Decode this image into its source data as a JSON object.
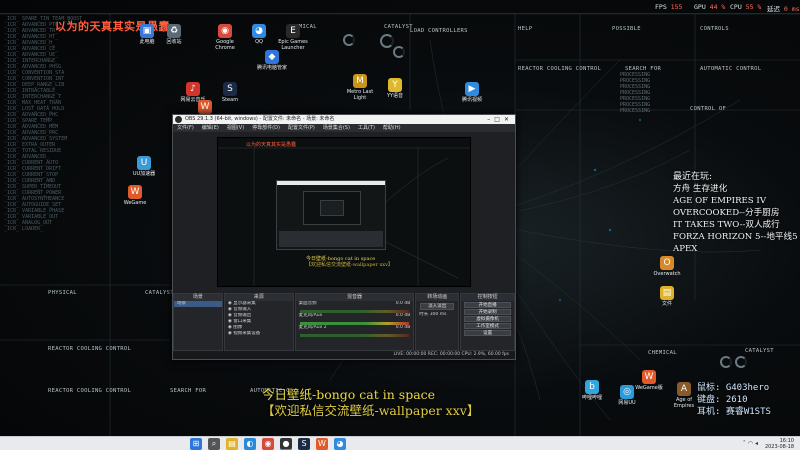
{
  "wallpaper": {
    "title_cn": "以为的天真其实是愚蠢",
    "topbar": [
      {
        "label": "FPS",
        "value": "155"
      },
      {
        "label": "GPU",
        "value": "44 %"
      },
      {
        "label": "CPU",
        "value": "55 %"
      },
      {
        "label": "延迟",
        "value": "0 ms"
      }
    ],
    "panels": {
      "catalyst": "CATALYST",
      "load_controllers": "LOAD CONTROLLERS",
      "help": "HELP",
      "possible": "POSSIBLE",
      "controls": "CONTROLS",
      "reactor_cooling": "REACTOR COOLING CONTROL",
      "search_for": "SEARCH FOR",
      "automatic_control": "AUTOMATIC CONTROL",
      "control_of": "CONTROL OF",
      "physical": "PHYSICAL",
      "chemical": "CHEMICAL",
      "reactor_cooling_2": "REACTOR COOLING CONTROL",
      "reactor_cooling_3": "REACTOR COOLING CONTROL",
      "search_for_2": "SEARCH FOR",
      "automatic_2": "AUTOMATIC C",
      "catalyst_2": "CATALYST",
      "chemical_2": "CHEMICAL"
    },
    "left_rows": [
      "_ICR_ SPARE_TIN TEAM_BOOST",
      "_ICR_ ADVANCED_PTC",
      "_ICR_ ADVANCED_TR_",
      "_ICR_ ADVANCED_HT_",
      "_ICR_ ADVANCED_H_",
      "_ICR_ ADVANCED_CE_",
      "_ICR_ ADVANCED_UE_",
      "_ICR_ INTERCHANGE_",
      "_ICR_ ADVANCED PHSG",
      "_ICR_ CONVENTION_STA",
      "_ICR_ CONVENTION_INT",
      "_ICR_ DEEP_RANGE_LIB",
      "_ICR_ INTRACTABLE_",
      "_ICR_ INTERCHANGE_T",
      "_ICR_ MAX_HEAT_TRAN",
      "_ICR_ LOST_DATA_HOLD",
      "_ICR_ ADVANCED_PHC",
      "_ICR_ SPARE_TEMP_",
      "_ICR_ ADVANCED_MEM",
      "_ICR_ ADVANCED_PRC",
      "_ICR_ ADVANCED SYSTEM",
      "_ICR_ EXTRA_OUTER",
      "_ICR_ TOTAL RESIDUE",
      "_ICR_ ADVANCED_",
      "_ICR_ CURRENT_AUTO",
      "_ICR_ CURRENT_DRIFT",
      "_ICR_ CURRENT_STOP",
      "_ICR_ CURRENT_AND",
      "_ICR_ SUPER_TIMEOUT",
      "_ICR_ CURRENT_POWER",
      "_ICR_ AUTOSYNTHEANCE",
      "_ICR_ AUTOGUIDE_SET",
      "_ICR_ VARIABLE_PHASE",
      "_ICR_ VARIABLE_OUT",
      "_ICR_ ANALOG_OUT",
      "_ICR_ LOADER_"
    ],
    "right_rows": [
      "PROCESSING",
      "PROCESSING",
      "PROCESSING",
      "PROCESSING",
      "PROCESSING",
      "PROCESSING",
      "PROCESSING"
    ]
  },
  "desktop_icons": [
    {
      "name": "此电脑",
      "glyph": "▣",
      "color": "#3a78d8"
    },
    {
      "name": "回收站",
      "glyph": "♻",
      "color": "#5a6a78"
    },
    {
      "name": "Google Chrome",
      "glyph": "◉",
      "color": "#d84a3a"
    },
    {
      "name": "QQ",
      "glyph": "◕",
      "color": "#2f8ae0"
    },
    {
      "name": "Epic Games Launcher",
      "glyph": "E",
      "color": "#2a2a2a"
    },
    {
      "name": "腾讯电脑管家",
      "glyph": "◆",
      "color": "#2f76d8"
    },
    {
      "name": "网易云音乐",
      "glyph": "♪",
      "color": "#d2352b"
    },
    {
      "name": "WeGame",
      "glyph": "W",
      "color": "#e05a2a"
    },
    {
      "name": "Steam",
      "glyph": "S",
      "color": "#1b2b44"
    },
    {
      "name": "Metro Last Light",
      "glyph": "M",
      "color": "#c9941a"
    },
    {
      "name": "YY语音",
      "glyph": "Y",
      "color": "#e0b92a"
    },
    {
      "name": "腾讯视频",
      "glyph": "▶",
      "color": "#2f8ae0"
    },
    {
      "name": "UU加速器",
      "glyph": "U",
      "color": "#3a9ad8"
    },
    {
      "name": "WeGame",
      "glyph": "W",
      "color": "#e05a2a"
    },
    {
      "name": "Overwatch",
      "glyph": "O",
      "color": "#d88a2a"
    },
    {
      "name": "文件",
      "glyph": "▤",
      "color": "#e0b12a"
    },
    {
      "name": "WeGame版",
      "glyph": "W",
      "color": "#e05a2a"
    },
    {
      "name": "Age of Empires",
      "glyph": "A",
      "color": "#8a5a2a"
    },
    {
      "name": "网易UU",
      "glyph": "◎",
      "color": "#2a9ad8"
    },
    {
      "name": "哔哩哔哩",
      "glyph": "b",
      "color": "#2fa6de"
    }
  ],
  "obs": {
    "title": "OBS 29.1.3 (64-bit, windows) - 配置文件: 未命名 - 场景: 未命名",
    "menu": [
      "文件(F)",
      "编辑(E)",
      "视图(V)",
      "停靠部件(D)",
      "配置文件(P)",
      "场景集合(S)",
      "工具(T)",
      "帮助(H)"
    ],
    "docks": {
      "scenes": {
        "title": "场景",
        "items": [
          "场景"
        ]
      },
      "sources": {
        "title": "来源",
        "items": [
          "显示器采集",
          "音频输入",
          "音频输出",
          "窗口采集",
          "图像",
          "视频采集设备"
        ]
      },
      "mixer": {
        "title": "混音器",
        "channels": [
          "桌面音频",
          "麦克风/Aux",
          "麦克风/Aux 2"
        ],
        "db": [
          "0.0 dB",
          "0.0 dB",
          "0.0 dB"
        ]
      },
      "transitions": {
        "title": "转场动画",
        "fade": "淡入淡出",
        "duration_label": "时长",
        "duration": "300 ms"
      },
      "controls": {
        "title": "控制按钮",
        "buttons": [
          "开始直播",
          "开始录制",
          "虚拟摄像机",
          "工作室模式",
          "设置",
          "退出"
        ]
      }
    },
    "status": "LIVE: 00:00:00   REC: 00:00:00   CPU: 2.9%, 60.00 fps",
    "preview_caption": "今日壁纸-bongo cat in space",
    "preview_caption2": "【欢迎私信交流壁纸-wallpaper xxv】"
  },
  "recent": {
    "title": "最近在玩:",
    "games": [
      "方舟 生存进化",
      "AGE OF EMPIRES IV",
      "OVERCOOKED--分手厨房",
      "IT TAKES TWO--双人成行",
      "FORZA HORIZON 5--地平线5",
      "APEX"
    ]
  },
  "caption": {
    "line1": "今日壁纸-bongo cat in space",
    "line2": "【欢迎私信交流壁纸-wallpaper xxv】"
  },
  "overlay_br": [
    "鼠标: G403hero",
    "键盘: 2610",
    "耳机: 赛睿W1STS"
  ],
  "taskbar": {
    "apps": [
      {
        "name": "start",
        "glyph": "⊞",
        "color": "#2f76d8"
      },
      {
        "name": "search",
        "glyph": "⌕",
        "color": "#555"
      },
      {
        "name": "file-explorer",
        "glyph": "▤",
        "color": "#e0b12a"
      },
      {
        "name": "edge",
        "glyph": "◐",
        "color": "#2a8ad8"
      },
      {
        "name": "chrome",
        "glyph": "◉",
        "color": "#d84a3a"
      },
      {
        "name": "obs",
        "glyph": "●",
        "color": "#333"
      },
      {
        "name": "steam",
        "glyph": "S",
        "color": "#1b2b44"
      },
      {
        "name": "wegame",
        "glyph": "W",
        "color": "#e05a2a"
      },
      {
        "name": "qq",
        "glyph": "◕",
        "color": "#2f8ae0"
      }
    ],
    "time": "16:10",
    "date": "2023-08-18"
  },
  "colors": {
    "accent_red": "#ff5d3c",
    "caption_yellow": "#e8d84a"
  }
}
